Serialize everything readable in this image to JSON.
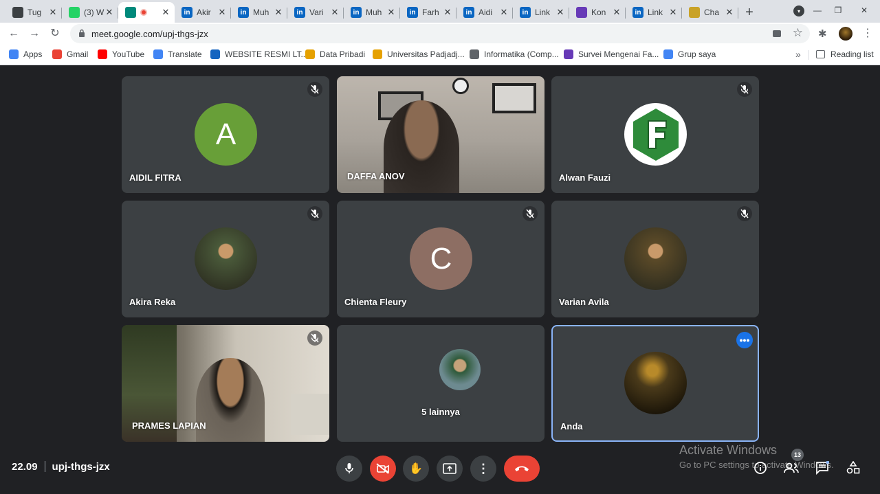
{
  "browser": {
    "tabs": [
      {
        "title": "Tug",
        "favicon": "classroom-icon",
        "color": "#3c4043"
      },
      {
        "title": "(3) W",
        "favicon": "whatsapp-icon",
        "color": "#25d366"
      },
      {
        "title": "",
        "favicon": "meet-icon",
        "color": "#00897b",
        "active": true
      },
      {
        "title": "Akir",
        "favicon": "linkedin-icon",
        "color": "#0a66c2"
      },
      {
        "title": "Muh",
        "favicon": "linkedin-icon",
        "color": "#0a66c2"
      },
      {
        "title": "Vari",
        "favicon": "linkedin-icon",
        "color": "#0a66c2"
      },
      {
        "title": "Muh",
        "favicon": "linkedin-icon",
        "color": "#0a66c2"
      },
      {
        "title": "Farh",
        "favicon": "linkedin-icon",
        "color": "#0a66c2"
      },
      {
        "title": "Aidi",
        "favicon": "linkedin-icon",
        "color": "#0a66c2"
      },
      {
        "title": "Link",
        "favicon": "linkedin-icon",
        "color": "#0a66c2"
      },
      {
        "title": "Kon",
        "favicon": "forms-icon",
        "color": "#673ab7"
      },
      {
        "title": "Link",
        "favicon": "linkedin-icon",
        "color": "#0a66c2"
      },
      {
        "title": "Cha",
        "favicon": "chainlink-icon",
        "color": "#c9a227"
      }
    ],
    "url": "meet.google.com/upj-thgs-jzx",
    "bookmarks": [
      {
        "label": "Apps",
        "icon": "apps-grid-icon",
        "color": "#4285f4"
      },
      {
        "label": "Gmail",
        "icon": "gmail-icon",
        "color": "#ea4335"
      },
      {
        "label": "YouTube",
        "icon": "youtube-icon",
        "color": "#ff0000"
      },
      {
        "label": "Translate",
        "icon": "translate-icon",
        "color": "#4285f4"
      },
      {
        "label": "WEBSITE RESMI LT...",
        "icon": "globe-icon",
        "color": "#1565c0"
      },
      {
        "label": "Data Pribadi",
        "icon": "unpad-icon",
        "color": "#e6a100"
      },
      {
        "label": "Universitas Padjadj...",
        "icon": "unpad-icon",
        "color": "#e6a100"
      },
      {
        "label": "Informatika (Comp...",
        "icon": "globe-icon",
        "color": "#5f6368"
      },
      {
        "label": "Survei Mengenai Fa...",
        "icon": "forms-icon",
        "color": "#673ab7"
      },
      {
        "label": "Grup saya",
        "icon": "groups-icon",
        "color": "#4285f4"
      }
    ],
    "reading_list": "Reading list"
  },
  "participants": [
    {
      "name": "AIDIL FITRA",
      "type": "letter",
      "letter": "A",
      "color": "#689f38",
      "muted": true
    },
    {
      "name": "DAFFA ANOV",
      "type": "video",
      "muted": false
    },
    {
      "name": "Alwan Fauzi",
      "type": "logo",
      "letter": "F",
      "color": "#2e8b3a",
      "muted": true
    },
    {
      "name": "Akira Reka",
      "type": "photo",
      "color": "#4a5a3a",
      "muted": true
    },
    {
      "name": "Chienta Fleury",
      "type": "letter",
      "letter": "C",
      "color": "#8d6e63",
      "muted": true
    },
    {
      "name": "Varian Avila",
      "type": "photo",
      "color": "#5b4a28",
      "muted": true
    },
    {
      "name": "PRAMES LAPIAN",
      "type": "video",
      "muted": true
    },
    {
      "name": "5 lainnya",
      "type": "others",
      "color": "#6d8a90",
      "muted": false
    },
    {
      "name": "Anda",
      "type": "self",
      "color": "#4a3a1a",
      "muted": false
    }
  ],
  "meeting": {
    "time": "22.09",
    "code": "upj-thgs-jzx",
    "people_count": "13"
  },
  "activation": {
    "title": "Activate Windows",
    "subtitle": "Go to PC settings to activate Windows."
  }
}
